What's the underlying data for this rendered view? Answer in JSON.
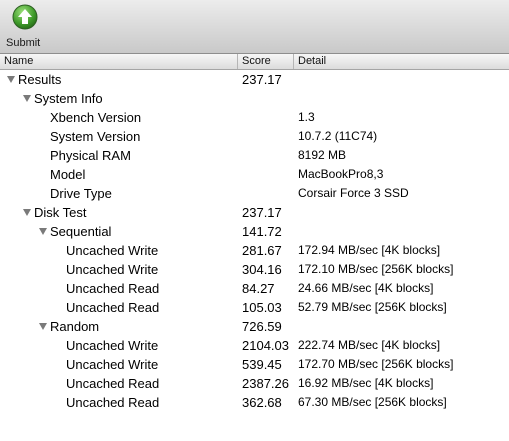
{
  "toolbar": {
    "submit_label": "Submit"
  },
  "columns": {
    "name": "Name",
    "score": "Score",
    "detail": "Detail"
  },
  "rows": [
    {
      "name": "Results",
      "score": "237.17",
      "detail": "",
      "expanded": true
    },
    {
      "name": "System Info",
      "score": "",
      "detail": "",
      "expanded": true
    },
    {
      "name": "Xbench Version",
      "score": "",
      "detail": "1.3"
    },
    {
      "name": "System Version",
      "score": "",
      "detail": "10.7.2 (11C74)"
    },
    {
      "name": "Physical RAM",
      "score": "",
      "detail": "8192 MB"
    },
    {
      "name": "Model",
      "score": "",
      "detail": "MacBookPro8,3"
    },
    {
      "name": "Drive Type",
      "score": "",
      "detail": "Corsair Force 3 SSD"
    },
    {
      "name": "Disk Test",
      "score": "237.17",
      "detail": "",
      "expanded": true
    },
    {
      "name": "Sequential",
      "score": "141.72",
      "detail": "",
      "expanded": true
    },
    {
      "name": "Uncached Write",
      "score": "281.67",
      "detail": "172.94 MB/sec [4K blocks]"
    },
    {
      "name": "Uncached Write",
      "score": "304.16",
      "detail": "172.10 MB/sec [256K blocks]"
    },
    {
      "name": "Uncached Read",
      "score": "84.27",
      "detail": "24.66 MB/sec [4K blocks]"
    },
    {
      "name": "Uncached Read",
      "score": "105.03",
      "detail": "52.79 MB/sec [256K blocks]"
    },
    {
      "name": "Random",
      "score": "726.59",
      "detail": "",
      "expanded": true
    },
    {
      "name": "Uncached Write",
      "score": "2104.03",
      "detail": "222.74 MB/sec [4K blocks]"
    },
    {
      "name": "Uncached Write",
      "score": "539.45",
      "detail": "172.70 MB/sec [256K blocks]"
    },
    {
      "name": "Uncached Read",
      "score": "2387.26",
      "detail": "16.92 MB/sec [4K blocks]"
    },
    {
      "name": "Uncached Read",
      "score": "362.68",
      "detail": "67.30 MB/sec [256K blocks]"
    }
  ]
}
